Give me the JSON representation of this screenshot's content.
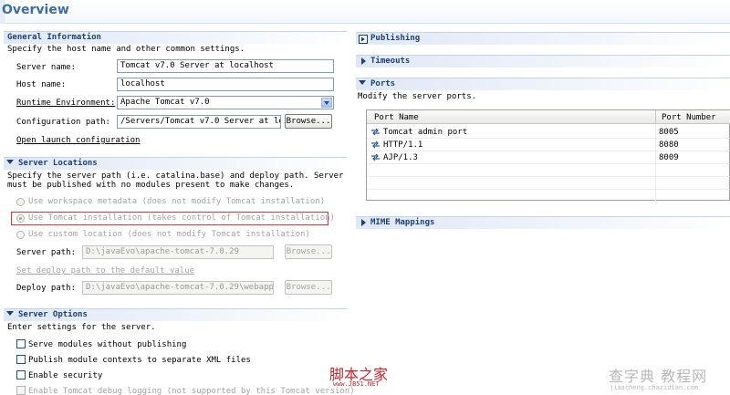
{
  "header": {
    "title": "Overview"
  },
  "general": {
    "heading": "General Information",
    "description": "Specify the host name and other common settings.",
    "server_name_label": "Server name:",
    "server_name_value": "Tomcat v7.0 Server at localhost",
    "host_name_label": "Host name:",
    "host_name_value": "localhost",
    "runtime_label": "Runtime Environment:",
    "runtime_value": "Apache Tomcat v7.0",
    "config_label": "Configuration path:",
    "config_value": "/Servers/Tomcat v7.0 Server at loc",
    "browse_label": "Browse...",
    "open_launch_label": "Open launch configuration"
  },
  "locations": {
    "heading": "Server Locations",
    "description_line1": "Specify the server path (i.e. catalina.base) and deploy path. Server",
    "description_line2": "must be published with no modules present to make changes.",
    "option_workspace": "Use workspace metadata (does not modify Tomcat installation)",
    "option_tomcat": "Use Tomcat installation (takes control of Tomcat installation)",
    "option_custom": "Use custom location (does not modify Tomcat installation)",
    "server_path_label": "Server path:",
    "server_path_value": "D:\\javaEvo\\apache-tomcat-7.0.29",
    "browse_label": "Browse...",
    "set_default_label": "Set deploy path to the default value",
    "deploy_path_label": "Deploy path:",
    "deploy_path_value": "D:\\javaEvo\\apache-tomcat-7.0.29\\webapps",
    "browse2_label": "Browse..."
  },
  "options": {
    "heading": "Server Options",
    "description": "Enter settings for the server.",
    "opt1": "Serve modules without publishing",
    "opt2": "Publish module contexts to separate XML files",
    "opt3": "Enable security",
    "opt4": "Enable Tomcat debug logging (not supported by this Tomcat version)"
  },
  "right": {
    "publishing": "Publishing",
    "timeouts": "Timeouts",
    "ports_heading": "Ports",
    "ports_description": "Modify the server ports.",
    "ports_col_name": "Port Name",
    "ports_col_number": "Port Number",
    "ports": [
      {
        "name": "Tomcat admin port",
        "number": "8005"
      },
      {
        "name": "HTTP/1.1",
        "number": "8080"
      },
      {
        "name": "AJP/1.3",
        "number": "8009"
      }
    ],
    "mime": "MIME Mappings"
  },
  "watermarks": {
    "site1": "脚本之家",
    "site1_url": "www.JB51.NET",
    "site2": "查字典 教程网",
    "site2_url": "jiaocheng.chazidian.com"
  },
  "colors": {
    "accent": "#3a6ea5",
    "heading": "#1c3f76",
    "highlight": "#e03434"
  }
}
